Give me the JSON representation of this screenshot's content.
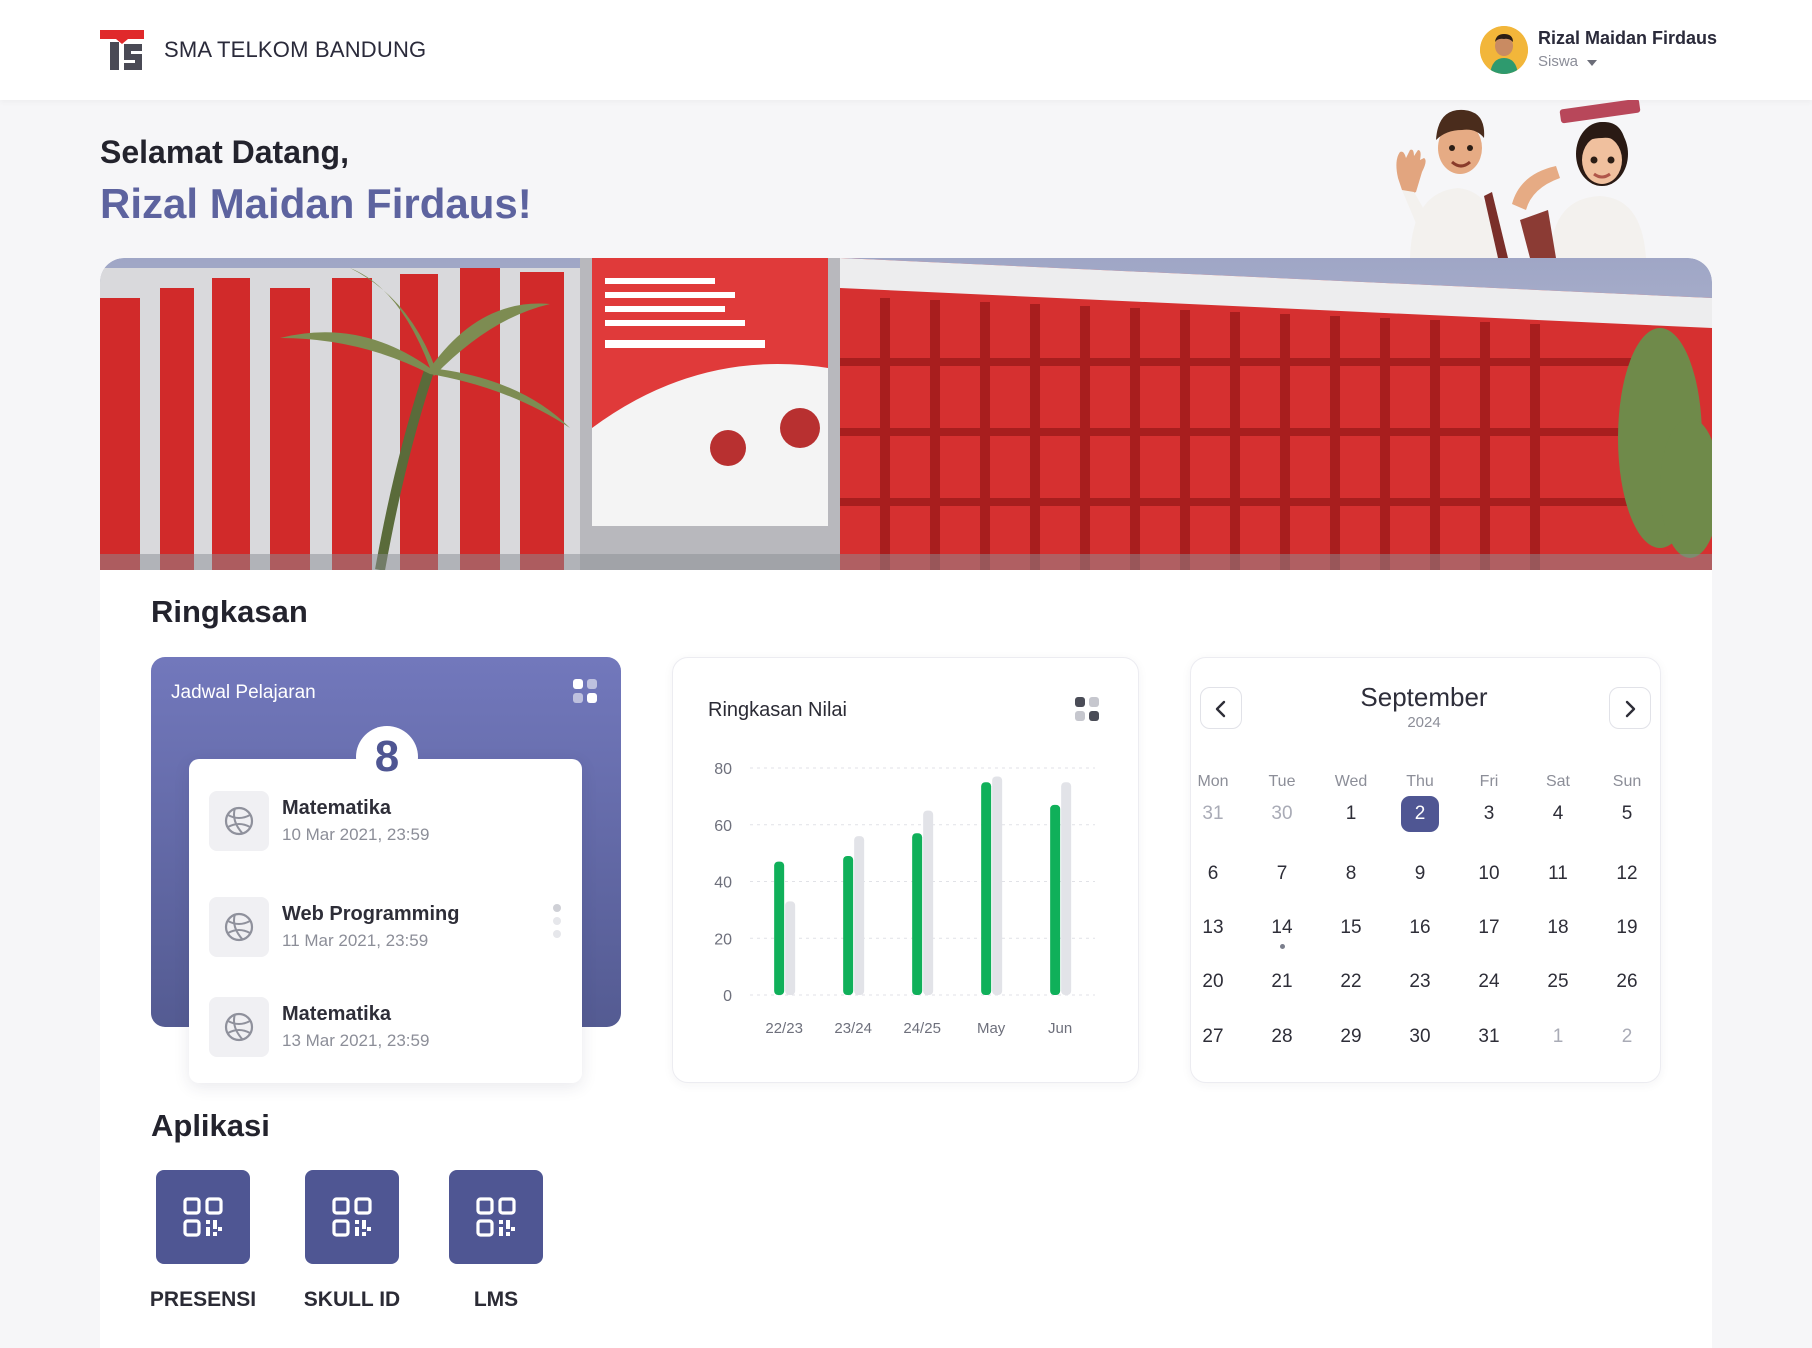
{
  "header": {
    "school_name": "SMA TELKOM BANDUNG",
    "user_name": "Rizal Maidan Firdaus",
    "user_role": "Siswa"
  },
  "welcome": {
    "greeting": "Selamat Datang,",
    "name": "Rizal Maidan Firdaus!"
  },
  "summary": {
    "title": "Ringkasan"
  },
  "schedule": {
    "title": "Jadwal Pelajaran",
    "count": "8",
    "items": [
      {
        "name": "Matematika",
        "date": "10 Mar 2021, 23:59"
      },
      {
        "name": "Web Programming",
        "date": "11 Mar 2021, 23:59"
      },
      {
        "name": "Matematika",
        "date": "13 Mar 2021, 23:59"
      }
    ]
  },
  "grades": {
    "title": "Ringkasan Nilai"
  },
  "chart_data": {
    "type": "bar",
    "title": "Ringkasan Nilai",
    "categories": [
      "22/23",
      "23/24",
      "24/25",
      "May",
      "Jun"
    ],
    "series": [
      {
        "values": [
          47,
          49,
          57,
          75,
          67
        ],
        "color": "#10b05a"
      },
      {
        "values": [
          33,
          56,
          65,
          77,
          75
        ],
        "color": "#e2e3e8"
      }
    ],
    "ylim": [
      0,
      80
    ],
    "yticks": [
      "0",
      "20",
      "40",
      "60",
      "80"
    ],
    "grid": true
  },
  "calendar": {
    "month": "September",
    "year": "2024",
    "weekdays": [
      "Mon",
      "Tue",
      "Wed",
      "Thu",
      "Fri",
      "Sat",
      "Sun"
    ],
    "weeks": [
      [
        {
          "d": "31",
          "m": true
        },
        {
          "d": "30",
          "m": true
        },
        {
          "d": "1"
        },
        {
          "d": "2",
          "today": true
        },
        {
          "d": "3"
        },
        {
          "d": "4"
        },
        {
          "d": "5"
        }
      ],
      [
        {
          "d": "6"
        },
        {
          "d": "7"
        },
        {
          "d": "8"
        },
        {
          "d": "9"
        },
        {
          "d": "10"
        },
        {
          "d": "11"
        },
        {
          "d": "12"
        }
      ],
      [
        {
          "d": "13"
        },
        {
          "d": "14",
          "dot": true
        },
        {
          "d": "15"
        },
        {
          "d": "16"
        },
        {
          "d": "17"
        },
        {
          "d": "18"
        },
        {
          "d": "19"
        }
      ],
      [
        {
          "d": "20"
        },
        {
          "d": "21"
        },
        {
          "d": "22"
        },
        {
          "d": "23"
        },
        {
          "d": "24"
        },
        {
          "d": "25"
        },
        {
          "d": "26"
        }
      ],
      [
        {
          "d": "27"
        },
        {
          "d": "28"
        },
        {
          "d": "29"
        },
        {
          "d": "30"
        },
        {
          "d": "31"
        },
        {
          "d": "1",
          "m": true
        },
        {
          "d": "2",
          "m": true
        }
      ]
    ]
  },
  "apps": {
    "title": "Aplikasi",
    "items": [
      {
        "label": "PRESENSI",
        "icon": "qr-code-icon"
      },
      {
        "label": "SKULL ID",
        "icon": "qr-code-icon"
      },
      {
        "label": "LMS",
        "icon": "qr-code-icon"
      }
    ]
  },
  "colors": {
    "primary": "#4f5693",
    "accent_green": "#10b05a",
    "brand_red": "#e0292b"
  }
}
